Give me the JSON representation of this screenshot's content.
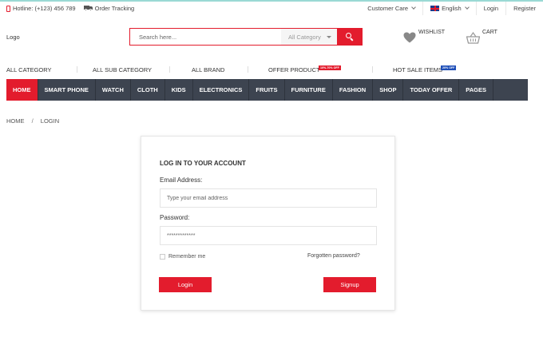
{
  "topbar": {
    "hotline": "Hotline: (+123) 456 789",
    "order_tracking": "Order Tracking",
    "customer_care": "Customer Care",
    "language": "English",
    "login": "Login",
    "register": "Register"
  },
  "header": {
    "logo": "Logo",
    "search_placeholder": "Search here...",
    "category_select": "All Category",
    "wishlist": "WISHLIST",
    "cart": "CART"
  },
  "category_row": {
    "items": [
      {
        "label": "ALL CATEGORY"
      },
      {
        "label": "ALL SUB CATEGORY"
      },
      {
        "label": "ALL BRAND"
      },
      {
        "label": "OFFER PRODUCT",
        "badge": "10%-70% OFF"
      },
      {
        "label": "HOT SALE ITEMS",
        "badge": "20% OFF"
      }
    ]
  },
  "nav": {
    "items": [
      "HOME",
      "SMART PHONE",
      "WATCH",
      "CLOTH",
      "KIDS",
      "ELECTRONICS",
      "FRUITS",
      "FURNITURE",
      "FASHION",
      "SHOP",
      "TODAY OFFER",
      "PAGES"
    ],
    "active_index": 0
  },
  "breadcrumb": {
    "home": "HOME",
    "separator": "/",
    "current": "LOGIN"
  },
  "login": {
    "title": "LOG IN TO YOUR ACCOUNT",
    "email_label": "Email Address:",
    "email_placeholder": "Type your email address",
    "password_label": "Password:",
    "password_value": "*************",
    "remember_label": "Remember me",
    "remember_checked": false,
    "forgot_label": "Forgotten password?",
    "login_button": "Login",
    "signup_button": "Signup"
  },
  "colors": {
    "accent": "#e31c2d",
    "nav_bg": "#3d4450",
    "badge_blue": "#1f4fb8"
  }
}
